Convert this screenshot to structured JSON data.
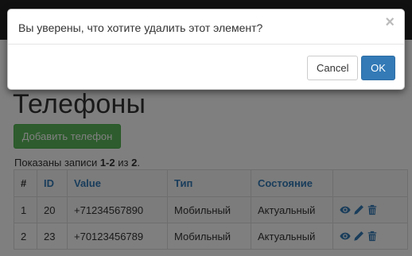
{
  "page": {
    "title": "Телефоны",
    "add_button_label": "Добавить телефон",
    "summary": {
      "prefix": "Показаны записи ",
      "range": "1-2",
      "middle": " из ",
      "total": "2",
      "suffix": "."
    }
  },
  "table": {
    "columns": [
      "#",
      "ID",
      "Value",
      "Тип",
      "Состояние",
      ""
    ],
    "rows": [
      {
        "num": "1",
        "id": "20",
        "value": "+71234567890",
        "type": "Мобильный",
        "state": "Актуальный"
      },
      {
        "num": "2",
        "id": "23",
        "value": "+70123456789",
        "type": "Мобильный",
        "state": "Актуальный"
      }
    ],
    "action_icons": [
      "eye-icon",
      "pencil-icon",
      "trash-icon"
    ]
  },
  "modal": {
    "message": "Вы уверены, что хотите удалить этот элемент?",
    "close_glyph": "×",
    "cancel_label": "Cancel",
    "ok_label": "OK"
  },
  "colors": {
    "navbar": "#222222",
    "success": "#5cb85c",
    "primary": "#337ab7",
    "link": "#337ab7"
  }
}
